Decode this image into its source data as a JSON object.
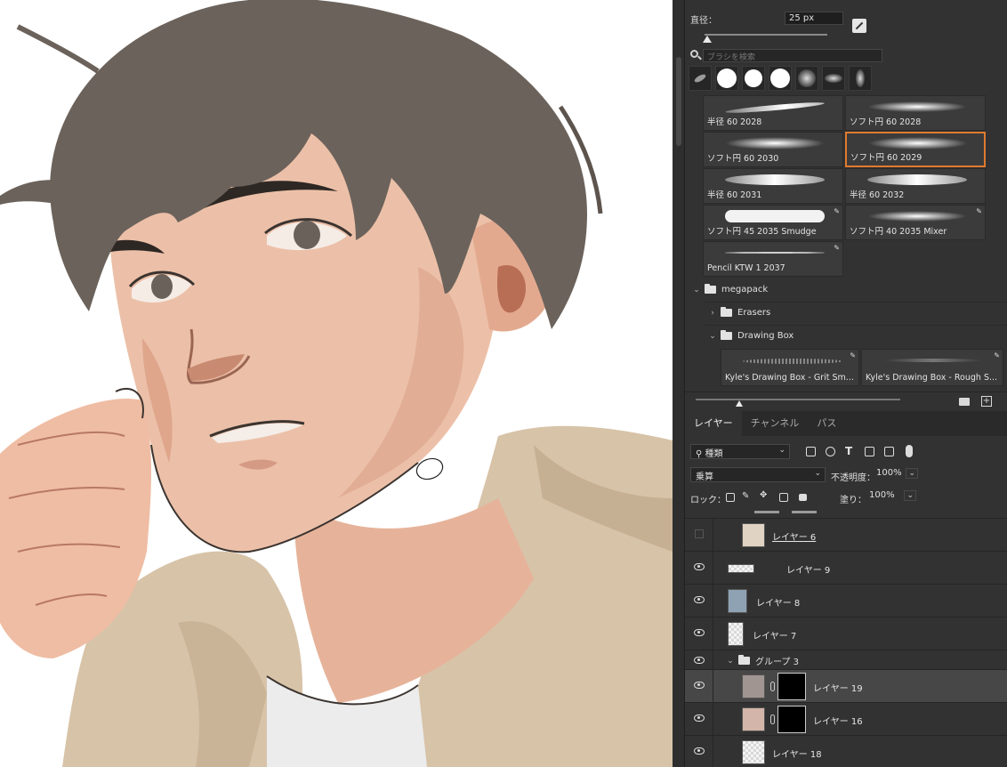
{
  "brush_panel": {
    "size_label": "直径：",
    "size_value": "25 px",
    "search_placeholder": "ブラシを検索",
    "presets": [
      {
        "label": "半径 60 2028"
      },
      {
        "label": "ソフト円 60 2028"
      },
      {
        "label": "ソフト円 60 2030"
      },
      {
        "label": "ソフト円 60 2029",
        "selected": true
      },
      {
        "label": "半径 60 2031"
      },
      {
        "label": "半径 60 2032"
      },
      {
        "label": "ソフト円 45 2035 Smudge"
      },
      {
        "label": "ソフト円 40 2035 Mixer"
      },
      {
        "label": "Pencil KTW 1 2037"
      }
    ],
    "folders": [
      {
        "name": "megapack",
        "expanded": true
      },
      {
        "name": "Erasers",
        "expanded": false
      },
      {
        "name": "Drawing Box",
        "expanded": true
      }
    ],
    "drawing_box_presets": [
      {
        "label": "Kyle's Drawing Box - Grit Sm..."
      },
      {
        "label": "Kyle's Drawing Box - Rough S..."
      }
    ],
    "selection_color": "#e07a2e"
  },
  "layers_panel": {
    "tabs": [
      {
        "label": "レイヤー",
        "active": true
      },
      {
        "label": "チャンネル"
      },
      {
        "label": "パス"
      }
    ],
    "filter_kind": "種類",
    "blend_mode": "乗算",
    "opacity_label": "不透明度：",
    "opacity_value": "100%",
    "lock_label": "ロック：",
    "fill_label": "塗り：",
    "fill_value": "100%",
    "layers": [
      {
        "name": "レイヤー 6",
        "visible": false,
        "underlined": true
      },
      {
        "name": "レイヤー 9",
        "visible": true
      },
      {
        "name": "レイヤー 8",
        "visible": true
      },
      {
        "name": "レイヤー 7",
        "visible": true
      },
      {
        "name": "グループ 3",
        "visible": true,
        "group": true
      },
      {
        "name": "レイヤー 19",
        "visible": true,
        "active": true
      },
      {
        "name": "レイヤー 16",
        "visible": true
      },
      {
        "name": "レイヤー 18",
        "visible": true
      }
    ]
  },
  "canvas": {
    "subject": "illustrated portrait of a young man with brown hair in a beige hoodie",
    "palette": {
      "hair": "#6b625b",
      "skin": "#ecc0a8",
      "skin_shadow": "#d49a82",
      "hoodie": "#d7c3a8",
      "hoodie_shadow": "#b8a287",
      "shirt": "#ececec",
      "line": "#3b3430"
    }
  }
}
